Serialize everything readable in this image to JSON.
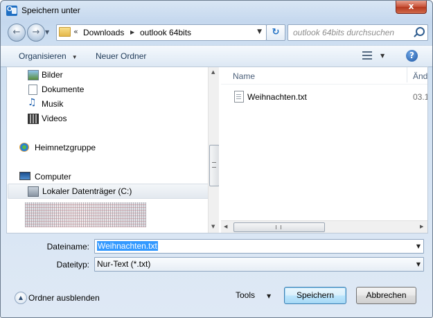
{
  "window": {
    "title": "Speichern unter",
    "close_label": "x"
  },
  "navigation": {
    "path": [
      "Downloads",
      "outlook 64bits"
    ],
    "path_prefix": "«",
    "search_placeholder": "outlook 64bits durchsuchen"
  },
  "toolbar": {
    "organize_label": "Organisieren",
    "new_folder_label": "Neuer Ordner"
  },
  "sidebar": {
    "items": [
      {
        "label": "Bilder",
        "icon": "pictures-icon"
      },
      {
        "label": "Dokumente",
        "icon": "documents-icon"
      },
      {
        "label": "Musik",
        "icon": "music-icon"
      },
      {
        "label": "Videos",
        "icon": "videos-icon"
      },
      {
        "label": "Heimnetzgruppe",
        "icon": "homegroup-icon"
      },
      {
        "label": "Computer",
        "icon": "computer-icon"
      },
      {
        "label": "Lokaler Datenträger (C:)",
        "icon": "local-disk-icon",
        "selected": true
      }
    ]
  },
  "file_list": {
    "columns": {
      "name": "Name",
      "date": "Änd"
    },
    "files": [
      {
        "name": "Weihnachten.txt",
        "date": "03.1"
      }
    ]
  },
  "form": {
    "filename_label": "Dateiname:",
    "filename_value": "Weihnachten.txt",
    "filetype_label": "Dateityp:",
    "filetype_value": "Nur-Text (*.txt)"
  },
  "footer": {
    "hide_folders_label": "Ordner ausblenden",
    "tools_label": "Tools",
    "save_label": "Speichern",
    "cancel_label": "Abbrechen"
  },
  "colors": {
    "accent": "#3399ff",
    "default_button": "#3c7fb1",
    "close_button": "#c75036"
  }
}
